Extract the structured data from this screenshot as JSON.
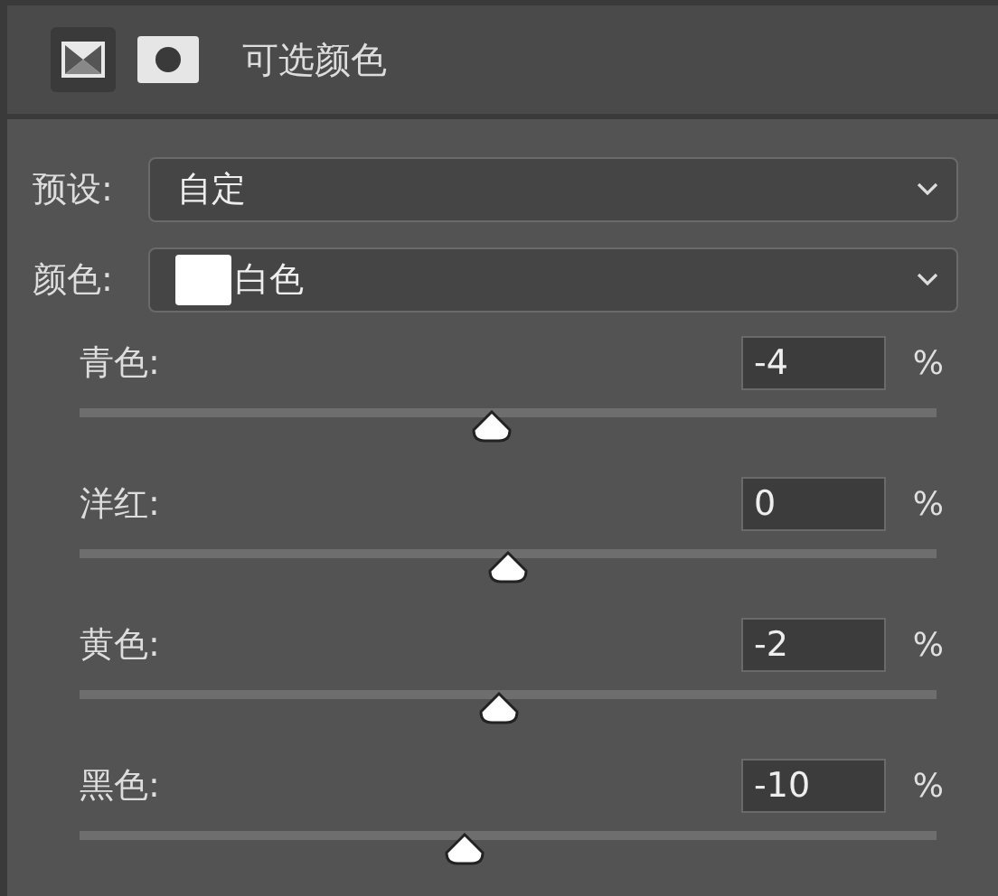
{
  "header": {
    "title": "可选颜色"
  },
  "preset": {
    "label": "预设:",
    "value": "自定"
  },
  "colors": {
    "label": "颜色:",
    "value": "白色"
  },
  "sliders": [
    {
      "label": "青色:",
      "value": "-4",
      "unit": "%",
      "level": 0.48
    },
    {
      "label": "洋红:",
      "value": "0",
      "unit": "%",
      "level": 0.5
    },
    {
      "label": "黄色:",
      "value": "-2",
      "unit": "%",
      "level": 0.49
    },
    {
      "label": "黑色:",
      "value": "-10",
      "unit": "%",
      "level": 0.45
    }
  ]
}
